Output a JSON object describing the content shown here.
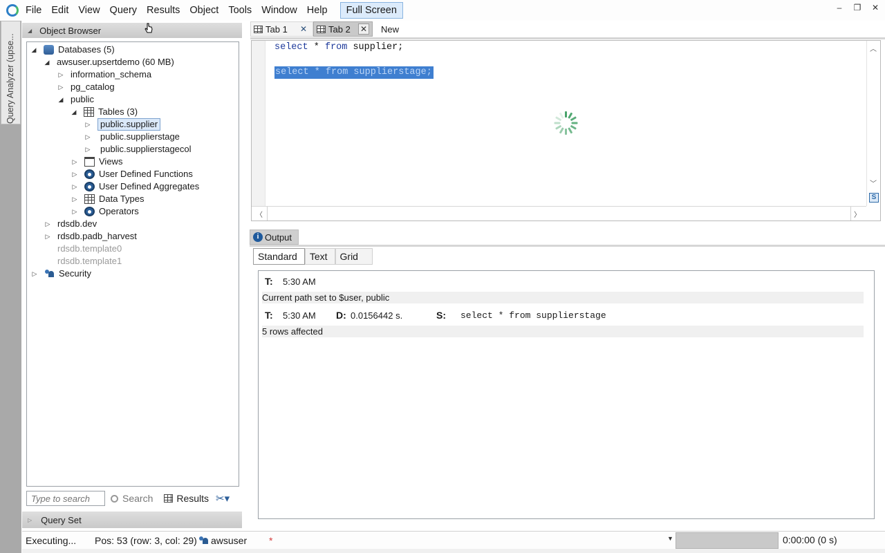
{
  "menu": {
    "items": [
      "File",
      "Edit",
      "View",
      "Query",
      "Results",
      "Object",
      "Tools",
      "Window",
      "Help"
    ],
    "fullscreen_label": "Full Screen"
  },
  "window_controls": {
    "minimize": "–",
    "restore": "❐",
    "close": "✕"
  },
  "side_strip": {
    "label": "Query Analyzer (upse..."
  },
  "object_browser": {
    "title": "Object Browser",
    "tree": {
      "databases": "Databases (5)",
      "db_main": "awsuser.upsertdemo (60 MB)",
      "schema_info": "information_schema",
      "schema_pg": "pg_catalog",
      "schema_public": "public",
      "tables": "Tables (3)",
      "table_supplier": "public.supplier",
      "table_supplierstage": "public.supplierstage",
      "table_supplierstagecol": "public.supplierstagecol",
      "views": "Views",
      "udf": "User Defined Functions",
      "uda": "User Defined Aggregates",
      "datatypes": "Data Types",
      "operators": "Operators",
      "db_dev": "rdsdb.dev",
      "db_padb": "rdsdb.padb_harvest",
      "db_template0": "rdsdb.template0",
      "db_template1": "rdsdb.template1",
      "security": "Security"
    },
    "search_placeholder": "Type to search",
    "search_label": "Search",
    "results_label": "Results"
  },
  "query_set": {
    "title": "Query Set"
  },
  "editor": {
    "tabs": {
      "tab1": "Tab 1",
      "tab2": "Tab 2",
      "new": "New",
      "close_glyph": "✕"
    },
    "line1": {
      "kw1": "select",
      "star": "*",
      "kw2": "from",
      "ident": "supplier;"
    },
    "line3_selected": "select * from supplierstage;"
  },
  "output": {
    "tab_label": "Output",
    "subtabs": [
      "Standard",
      "Text",
      "Grid"
    ],
    "messages": {
      "m1_t_label": "T:",
      "m1_time": "5:30 AM",
      "m2_text": "Current path set to $user, public",
      "m3_t_label": "T:",
      "m3_time": "5:30 AM",
      "m3_d_label": "D:",
      "m3_duration": "0.0156442 s.",
      "m3_s_label": "S:",
      "m3_sql": "select * from supplierstage",
      "m4_text": "5 rows affected"
    }
  },
  "status": {
    "state": "Executing...",
    "position": "Pos: 53 (row: 3, col: 29)",
    "user": "awsuser",
    "modified": "*",
    "timer": "0:00:00 (0 s)"
  },
  "colors": {
    "accent": "#3f7fd0",
    "keyword": "#1e3a9b",
    "spinner": "#48a36a"
  }
}
